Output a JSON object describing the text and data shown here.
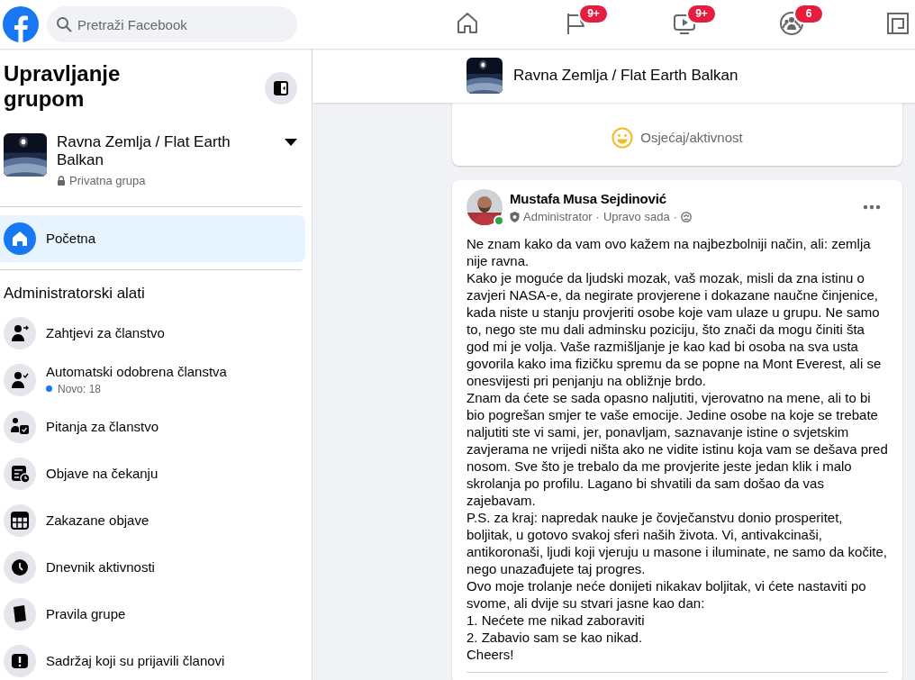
{
  "top_bar": {
    "search": {
      "placeholder": "Pretraži Facebook"
    },
    "nav": [
      {
        "kind": "home"
      },
      {
        "kind": "flag",
        "badge": "9+"
      },
      {
        "kind": "video",
        "badge": "9+"
      },
      {
        "kind": "groups",
        "badge": "6"
      },
      {
        "kind": "gaming"
      }
    ]
  },
  "sidebar": {
    "title": "Upravljanje grupom",
    "group": {
      "name": "Ravna Zemlja / Flat Earth Balkan",
      "privacy": "Privatna grupa"
    },
    "nav": [
      {
        "label": "Početna",
        "kind": "home",
        "selected": true
      }
    ],
    "section": "Administratorski alati",
    "tools": [
      {
        "label": "Zahtjevi za članstvo",
        "kind": "person-arrow"
      },
      {
        "label": "Automatski odobrena članstva",
        "kind": "person-check",
        "note": "Novo: 18"
      },
      {
        "label": "Pitanja za članstvo",
        "kind": "person-question"
      },
      {
        "label": "Objave na čekanju",
        "kind": "posts-clock"
      },
      {
        "label": "Zakazane objave",
        "kind": "calendar"
      },
      {
        "label": "Dnevnik aktivnosti",
        "kind": "clock"
      },
      {
        "label": "Pravila grupe",
        "kind": "book"
      },
      {
        "label": "Sadržaj koji su prijavili članovi",
        "kind": "alert"
      }
    ]
  },
  "group_header": {
    "name": "Ravna Zemlja / Flat Earth Balkan"
  },
  "composer": {
    "actions": [
      {
        "label": "Osjećaj/aktivnost",
        "kind": "smile"
      }
    ]
  },
  "post": {
    "author": "Mustafa Musa Sejdinović",
    "online": true,
    "role": "Administrator",
    "separator": "·",
    "time": "Upravo sada",
    "paragraphs": [
      "Ne znam kako da vam ovo kažem na najbezbolniji način, ali: zemlja nije ravna.",
      "Kako je moguće da ljudski mozak, vaš mozak, misli da zna istinu o zavjeri NASA-e, da negirate provjerene i dokazane naučne činjenice, kada niste u stanju provjeriti osobe koje vam ulaze u grupu. Ne samo to, nego ste mu dali adminsku poziciju, što znači da mogu činiti šta god mi je volja. Vaše razmišljanje je kao kad bi osoba na sva usta govorila kako ima fizičku spremu da se popne na Mont Everest, ali se onesvijesti pri penjanju na obližnje brdo.",
      "Znam da ćete se sada opasno naljutiti, vjerovatno na mene, ali to bi bio pogrešan smjer te vaše emocije. Jedine osobe na koje se trebate naljutiti ste vi sami, jer, ponavljam, saznavanje istine o svjetskim zavjerama ne vrijedi ništa ako ne vidite istinu koja vam se dešava pred nosom. Sve što je trebalo da me provjerite jeste jedan klik i malo skrolanja po profilu. Lagano bi shvatili da sam došao da vas zajebavam.",
      "P.S. za kraj: napredak nauke je čovječanstvu donio prosperitet, boljitak, u gotovo svakoj sferi naših života. Vi, antivakcinaši, antikoronaši, ljudi koji vjeruju u masone i iluminate, ne samo da kočite, nego unazađujete taj progres.",
      "Ovo moje trolanje neće donijeti nikakav boljitak, vi ćete nastaviti po svome, ali dvije su stvari jasne kao dan:",
      "1. Nećete me nikad zaboraviti",
      "2. Zabavio sam se kao nikad.",
      "Cheers!"
    ]
  }
}
